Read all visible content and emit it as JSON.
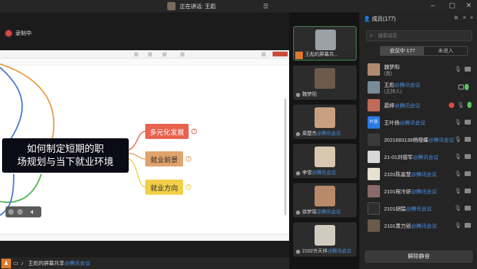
{
  "titlebar": {
    "speaking_label": "正在讲话: 王彪",
    "window_controls": [
      "minimize-icon",
      "maximize-icon",
      "close-icon"
    ]
  },
  "recording": {
    "label": "录制中"
  },
  "mindmap": {
    "root_line1": "如何制定短期的职",
    "root_line2": "场规划与当下就业环境",
    "nodes": [
      {
        "label": "多元化发展",
        "badge": "7",
        "color": "#e8624d"
      },
      {
        "label": "就业前景",
        "badge": "3",
        "color": "#e0a36c"
      },
      {
        "label": "就业方向",
        "badge": "7",
        "color": "#f2cf48"
      }
    ]
  },
  "statusbar": {
    "name": "王彪的屏幕共享",
    "tag": "@腾讯会议"
  },
  "videos": [
    {
      "name": "王彪的屏幕共...",
      "active": true
    },
    {
      "name": "魏梦阳"
    },
    {
      "name": "周楚杰",
      "tag": "@腾讯会议"
    },
    {
      "name": "李雪",
      "tag": "@腾讯会议"
    },
    {
      "name": "徐梦瑶",
      "tag": "@腾讯会议"
    },
    {
      "name": "2102许天祥",
      "tag": "@腾讯会议"
    }
  ],
  "panel": {
    "title": "成员(177)",
    "search_placeholder": "搜索成员",
    "tabs": [
      "会议中 177",
      "未进入"
    ],
    "members": [
      {
        "name": "魏梦阳",
        "sub": "(我)"
      },
      {
        "name": "王彪",
        "tag": "@腾讯会议",
        "sub": "(主持人)"
      },
      {
        "name": "晨婷",
        "tag": "@腾讯会议"
      },
      {
        "name": "王叶扬",
        "tag": "@腾讯会议",
        "avatar_text": "叶扬"
      },
      {
        "name": "2021683139杨晓蝶",
        "tag": "@腾讯会议"
      },
      {
        "name": "21-01刘德军",
        "tag": "@腾讯会议"
      },
      {
        "name": "2101陈嘉慧",
        "tag": "@腾讯会议"
      },
      {
        "name": "2101程冷妍",
        "tag": "@腾讯会议"
      },
      {
        "name": "2101胡猛",
        "tag": "@腾讯会议"
      },
      {
        "name": "2101黄力铭",
        "tag": "@腾讯会议"
      }
    ],
    "unmute_all_label": "解除静音"
  },
  "colors": {
    "accent_blue": "#4a90e2",
    "record_red": "#d84a4a",
    "share_orange": "#e07a2a"
  }
}
